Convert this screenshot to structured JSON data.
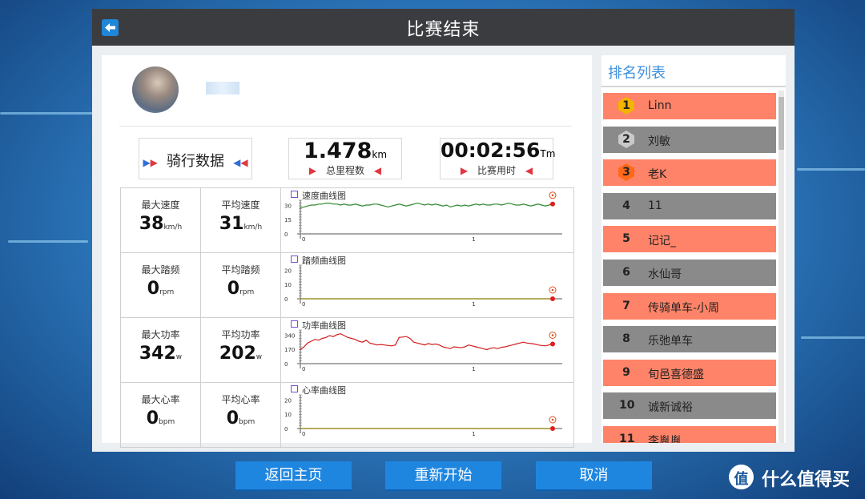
{
  "window": {
    "title": "比赛结束"
  },
  "user": {
    "avatar": "avatar-image",
    "name": ""
  },
  "summary": {
    "ride_data_label": "骑行数据",
    "distance": {
      "value": "1.478",
      "unit": "km",
      "label": "总里程数"
    },
    "time": {
      "value": "00:02:56",
      "unit": "Tm",
      "label": "比赛用时"
    }
  },
  "stats": [
    {
      "max_label": "最大速度",
      "max_value": "38",
      "max_unit": "km/h",
      "avg_label": "平均速度",
      "avg_value": "31",
      "avg_unit": "km/h",
      "chart_title": "速度曲线图"
    },
    {
      "max_label": "最大踏频",
      "max_value": "0",
      "max_unit": "rpm",
      "avg_label": "平均踏频",
      "avg_value": "0",
      "avg_unit": "rpm",
      "chart_title": "踏频曲线图"
    },
    {
      "max_label": "最大功率",
      "max_value": "342",
      "max_unit": "w",
      "avg_label": "平均功率",
      "avg_value": "202",
      "avg_unit": "w",
      "chart_title": "功率曲线图"
    },
    {
      "max_label": "最大心率",
      "max_value": "0",
      "max_unit": "bpm",
      "avg_label": "平均心率",
      "avg_value": "0",
      "avg_unit": "bpm",
      "chart_title": "心率曲线图"
    }
  ],
  "chart_data": [
    {
      "type": "line",
      "title": "速度曲线图",
      "color": "#2e8b2e",
      "yticks": [
        "30",
        "15",
        "0"
      ],
      "xticks": [
        "0",
        "1"
      ],
      "ylim": [
        0,
        35
      ],
      "values": [
        27,
        28,
        29,
        30,
        30,
        31,
        31,
        32,
        32,
        31,
        31,
        30,
        31,
        30,
        30,
        31,
        30,
        29,
        30,
        30,
        31,
        31,
        30,
        29,
        28,
        29,
        30,
        31,
        30,
        29,
        30,
        31,
        32,
        31,
        30,
        31,
        30,
        31,
        30,
        29,
        30,
        28,
        29,
        30,
        29,
        30,
        29,
        30,
        31,
        30,
        31,
        30,
        30,
        31,
        31,
        30,
        31,
        32,
        31,
        30,
        30,
        31,
        30,
        29,
        30,
        31,
        30,
        29,
        30,
        31
      ]
    },
    {
      "type": "line",
      "title": "踏频曲线图",
      "color": "#8a7a00",
      "yticks": [
        "20",
        "10",
        "0"
      ],
      "xticks": [
        "0",
        "1"
      ],
      "ylim": [
        0,
        22
      ],
      "values": [
        0,
        0,
        0,
        0,
        0,
        0,
        0,
        0,
        0,
        0,
        0,
        0
      ]
    },
    {
      "type": "line",
      "title": "功率曲线图",
      "color": "#d21e1e",
      "yticks": [
        "340",
        "170",
        "0"
      ],
      "xticks": [
        "0",
        "1"
      ],
      "ylim": [
        0,
        360
      ],
      "values": [
        150,
        180,
        220,
        240,
        260,
        250,
        270,
        280,
        300,
        290,
        310,
        320,
        300,
        280,
        270,
        260,
        240,
        230,
        250,
        220,
        210,
        200,
        205,
        200,
        195,
        190,
        200,
        280,
        285,
        290,
        270,
        230,
        220,
        210,
        200,
        215,
        205,
        210,
        200,
        180,
        170,
        160,
        180,
        175,
        170,
        180,
        200,
        190,
        180,
        170,
        160,
        150,
        165,
        170,
        160,
        175,
        180,
        190,
        200,
        210,
        220,
        230,
        220,
        215,
        210,
        200,
        195,
        190,
        200,
        210
      ]
    },
    {
      "type": "line",
      "title": "心率曲线图",
      "color": "#8a7a00",
      "yticks": [
        "20",
        "10",
        "0"
      ],
      "xticks": [
        "0",
        "1"
      ],
      "ylim": [
        0,
        22
      ],
      "values": [
        0,
        0,
        0,
        0,
        0,
        0,
        0,
        0,
        0,
        0,
        0,
        0
      ]
    }
  ],
  "ranking": {
    "title": "排名列表",
    "items": [
      {
        "rank": "1",
        "name": "Linn",
        "color": "#ff8368",
        "badge": "gold-badge-icon"
      },
      {
        "rank": "2",
        "name": "刘敏",
        "color": "#8a8a8a",
        "badge": "silver-badge-icon"
      },
      {
        "rank": "3",
        "name": "老K",
        "color": "#ff8368",
        "badge": "bronze-badge-icon"
      },
      {
        "rank": "4",
        "name": "11",
        "color": "#8a8a8a"
      },
      {
        "rank": "5",
        "name": "记记_",
        "color": "#ff8368"
      },
      {
        "rank": "6",
        "name": "水仙哥",
        "color": "#8a8a8a"
      },
      {
        "rank": "7",
        "name": "传骑单车-小周",
        "color": "#ff8368"
      },
      {
        "rank": "8",
        "name": "乐弛单车",
        "color": "#8a8a8a"
      },
      {
        "rank": "9",
        "name": "旬邑喜德盛",
        "color": "#ff8368"
      },
      {
        "rank": "10",
        "name": "诚新诚裕",
        "color": "#8a8a8a"
      },
      {
        "rank": "11",
        "name": "李胤胤",
        "color": "#ff8368"
      }
    ]
  },
  "buttons": {
    "home": "返回主页",
    "restart": "重新开始",
    "cancel": "取消"
  },
  "watermark": {
    "text": "什么值得买",
    "glyph": "值"
  }
}
